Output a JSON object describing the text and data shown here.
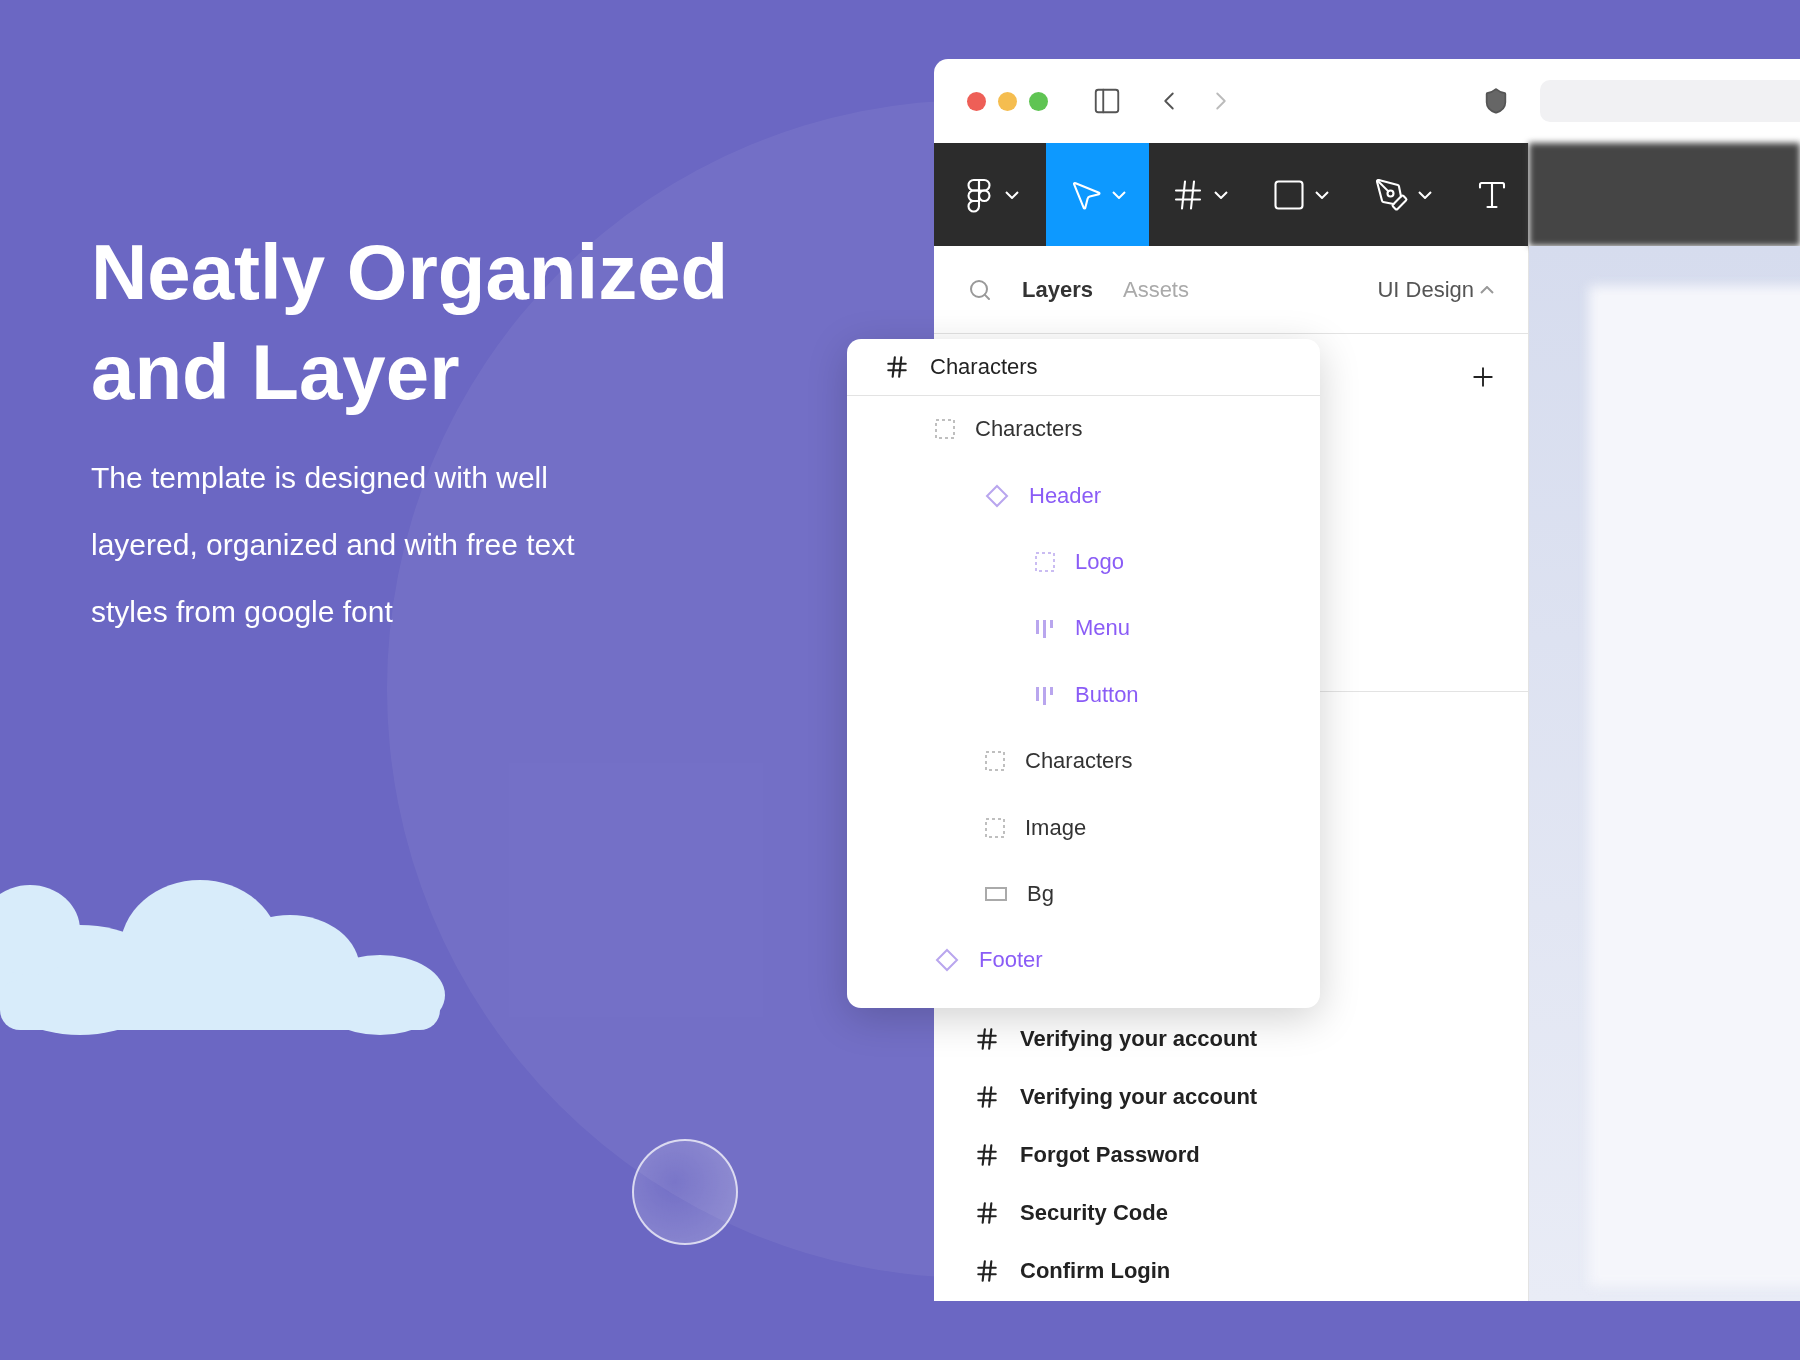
{
  "headline": [
    "Neatly Organized",
    "and Layer"
  ],
  "body": [
    "The template is designed with well",
    "layered, organized and with free text",
    "styles from google font"
  ],
  "toolbar": [
    {
      "kind": "main-menu",
      "selected": false,
      "dropdown": true
    },
    {
      "kind": "move",
      "selected": true,
      "dropdown": true
    },
    {
      "kind": "frame",
      "selected": false,
      "dropdown": true
    },
    {
      "kind": "rectangle",
      "selected": false,
      "dropdown": true
    },
    {
      "kind": "pen",
      "selected": false,
      "dropdown": true
    },
    {
      "kind": "text",
      "selected": false,
      "dropdown": false
    }
  ],
  "tabs": [
    {
      "label": "Layers",
      "selected": true
    },
    {
      "label": "Assets",
      "selected": false
    }
  ],
  "page_selector": {
    "label": "UI Design",
    "expanded": true
  },
  "layers": [
    "Verifying your account",
    "Verifying your account",
    "Forgot Password",
    "Security Code",
    "Confirm Login"
  ],
  "layer_popup": {
    "title": "Characters",
    "children": [
      {
        "label": "Characters",
        "kind": "group",
        "component": false,
        "children": [
          {
            "label": "Header",
            "kind": "component",
            "component": true,
            "children": [
              {
                "label": "Logo",
                "kind": "group",
                "component": true
              },
              {
                "label": "Menu",
                "kind": "autolayout",
                "component": true
              },
              {
                "label": "Button",
                "kind": "autolayout",
                "component": true
              }
            ]
          },
          {
            "label": "Characters",
            "kind": "group",
            "component": false
          },
          {
            "label": "Image",
            "kind": "group",
            "component": false
          },
          {
            "label": "Bg",
            "kind": "rectangle",
            "component": false
          }
        ]
      },
      {
        "label": "Footer",
        "kind": "component",
        "component": true
      }
    ]
  }
}
